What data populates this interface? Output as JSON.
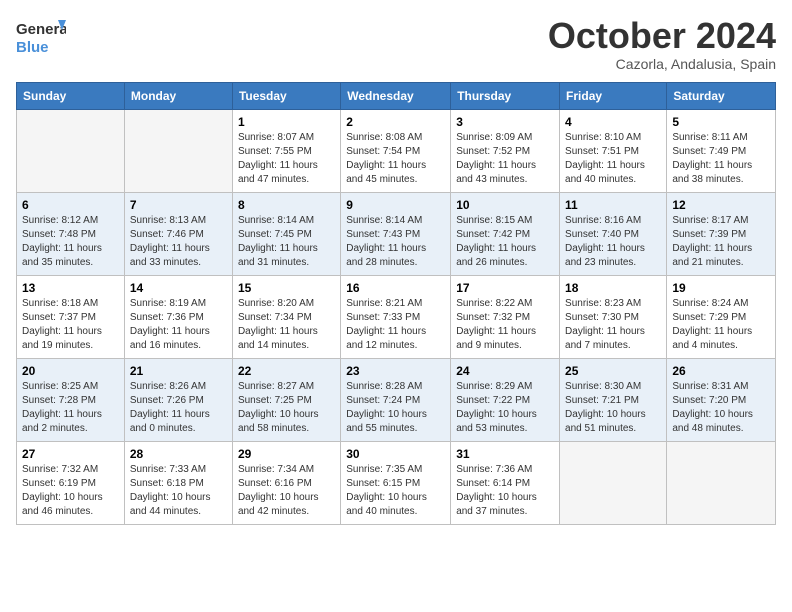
{
  "header": {
    "logo_line1": "General",
    "logo_line2": "Blue",
    "month": "October 2024",
    "location": "Cazorla, Andalusia, Spain"
  },
  "columns": [
    "Sunday",
    "Monday",
    "Tuesday",
    "Wednesday",
    "Thursday",
    "Friday",
    "Saturday"
  ],
  "rows": [
    [
      {
        "day": "",
        "empty": true
      },
      {
        "day": "",
        "empty": true
      },
      {
        "day": "1",
        "sunrise": "Sunrise: 8:07 AM",
        "sunset": "Sunset: 7:55 PM",
        "daylight": "Daylight: 11 hours and 47 minutes."
      },
      {
        "day": "2",
        "sunrise": "Sunrise: 8:08 AM",
        "sunset": "Sunset: 7:54 PM",
        "daylight": "Daylight: 11 hours and 45 minutes."
      },
      {
        "day": "3",
        "sunrise": "Sunrise: 8:09 AM",
        "sunset": "Sunset: 7:52 PM",
        "daylight": "Daylight: 11 hours and 43 minutes."
      },
      {
        "day": "4",
        "sunrise": "Sunrise: 8:10 AM",
        "sunset": "Sunset: 7:51 PM",
        "daylight": "Daylight: 11 hours and 40 minutes."
      },
      {
        "day": "5",
        "sunrise": "Sunrise: 8:11 AM",
        "sunset": "Sunset: 7:49 PM",
        "daylight": "Daylight: 11 hours and 38 minutes."
      }
    ],
    [
      {
        "day": "6",
        "sunrise": "Sunrise: 8:12 AM",
        "sunset": "Sunset: 7:48 PM",
        "daylight": "Daylight: 11 hours and 35 minutes."
      },
      {
        "day": "7",
        "sunrise": "Sunrise: 8:13 AM",
        "sunset": "Sunset: 7:46 PM",
        "daylight": "Daylight: 11 hours and 33 minutes."
      },
      {
        "day": "8",
        "sunrise": "Sunrise: 8:14 AM",
        "sunset": "Sunset: 7:45 PM",
        "daylight": "Daylight: 11 hours and 31 minutes."
      },
      {
        "day": "9",
        "sunrise": "Sunrise: 8:14 AM",
        "sunset": "Sunset: 7:43 PM",
        "daylight": "Daylight: 11 hours and 28 minutes."
      },
      {
        "day": "10",
        "sunrise": "Sunrise: 8:15 AM",
        "sunset": "Sunset: 7:42 PM",
        "daylight": "Daylight: 11 hours and 26 minutes."
      },
      {
        "day": "11",
        "sunrise": "Sunrise: 8:16 AM",
        "sunset": "Sunset: 7:40 PM",
        "daylight": "Daylight: 11 hours and 23 minutes."
      },
      {
        "day": "12",
        "sunrise": "Sunrise: 8:17 AM",
        "sunset": "Sunset: 7:39 PM",
        "daylight": "Daylight: 11 hours and 21 minutes."
      }
    ],
    [
      {
        "day": "13",
        "sunrise": "Sunrise: 8:18 AM",
        "sunset": "Sunset: 7:37 PM",
        "daylight": "Daylight: 11 hours and 19 minutes."
      },
      {
        "day": "14",
        "sunrise": "Sunrise: 8:19 AM",
        "sunset": "Sunset: 7:36 PM",
        "daylight": "Daylight: 11 hours and 16 minutes."
      },
      {
        "day": "15",
        "sunrise": "Sunrise: 8:20 AM",
        "sunset": "Sunset: 7:34 PM",
        "daylight": "Daylight: 11 hours and 14 minutes."
      },
      {
        "day": "16",
        "sunrise": "Sunrise: 8:21 AM",
        "sunset": "Sunset: 7:33 PM",
        "daylight": "Daylight: 11 hours and 12 minutes."
      },
      {
        "day": "17",
        "sunrise": "Sunrise: 8:22 AM",
        "sunset": "Sunset: 7:32 PM",
        "daylight": "Daylight: 11 hours and 9 minutes."
      },
      {
        "day": "18",
        "sunrise": "Sunrise: 8:23 AM",
        "sunset": "Sunset: 7:30 PM",
        "daylight": "Daylight: 11 hours and 7 minutes."
      },
      {
        "day": "19",
        "sunrise": "Sunrise: 8:24 AM",
        "sunset": "Sunset: 7:29 PM",
        "daylight": "Daylight: 11 hours and 4 minutes."
      }
    ],
    [
      {
        "day": "20",
        "sunrise": "Sunrise: 8:25 AM",
        "sunset": "Sunset: 7:28 PM",
        "daylight": "Daylight: 11 hours and 2 minutes."
      },
      {
        "day": "21",
        "sunrise": "Sunrise: 8:26 AM",
        "sunset": "Sunset: 7:26 PM",
        "daylight": "Daylight: 11 hours and 0 minutes."
      },
      {
        "day": "22",
        "sunrise": "Sunrise: 8:27 AM",
        "sunset": "Sunset: 7:25 PM",
        "daylight": "Daylight: 10 hours and 58 minutes."
      },
      {
        "day": "23",
        "sunrise": "Sunrise: 8:28 AM",
        "sunset": "Sunset: 7:24 PM",
        "daylight": "Daylight: 10 hours and 55 minutes."
      },
      {
        "day": "24",
        "sunrise": "Sunrise: 8:29 AM",
        "sunset": "Sunset: 7:22 PM",
        "daylight": "Daylight: 10 hours and 53 minutes."
      },
      {
        "day": "25",
        "sunrise": "Sunrise: 8:30 AM",
        "sunset": "Sunset: 7:21 PM",
        "daylight": "Daylight: 10 hours and 51 minutes."
      },
      {
        "day": "26",
        "sunrise": "Sunrise: 8:31 AM",
        "sunset": "Sunset: 7:20 PM",
        "daylight": "Daylight: 10 hours and 48 minutes."
      }
    ],
    [
      {
        "day": "27",
        "sunrise": "Sunrise: 7:32 AM",
        "sunset": "Sunset: 6:19 PM",
        "daylight": "Daylight: 10 hours and 46 minutes."
      },
      {
        "day": "28",
        "sunrise": "Sunrise: 7:33 AM",
        "sunset": "Sunset: 6:18 PM",
        "daylight": "Daylight: 10 hours and 44 minutes."
      },
      {
        "day": "29",
        "sunrise": "Sunrise: 7:34 AM",
        "sunset": "Sunset: 6:16 PM",
        "daylight": "Daylight: 10 hours and 42 minutes."
      },
      {
        "day": "30",
        "sunrise": "Sunrise: 7:35 AM",
        "sunset": "Sunset: 6:15 PM",
        "daylight": "Daylight: 10 hours and 40 minutes."
      },
      {
        "day": "31",
        "sunrise": "Sunrise: 7:36 AM",
        "sunset": "Sunset: 6:14 PM",
        "daylight": "Daylight: 10 hours and 37 minutes."
      },
      {
        "day": "",
        "empty": true
      },
      {
        "day": "",
        "empty": true
      }
    ]
  ]
}
